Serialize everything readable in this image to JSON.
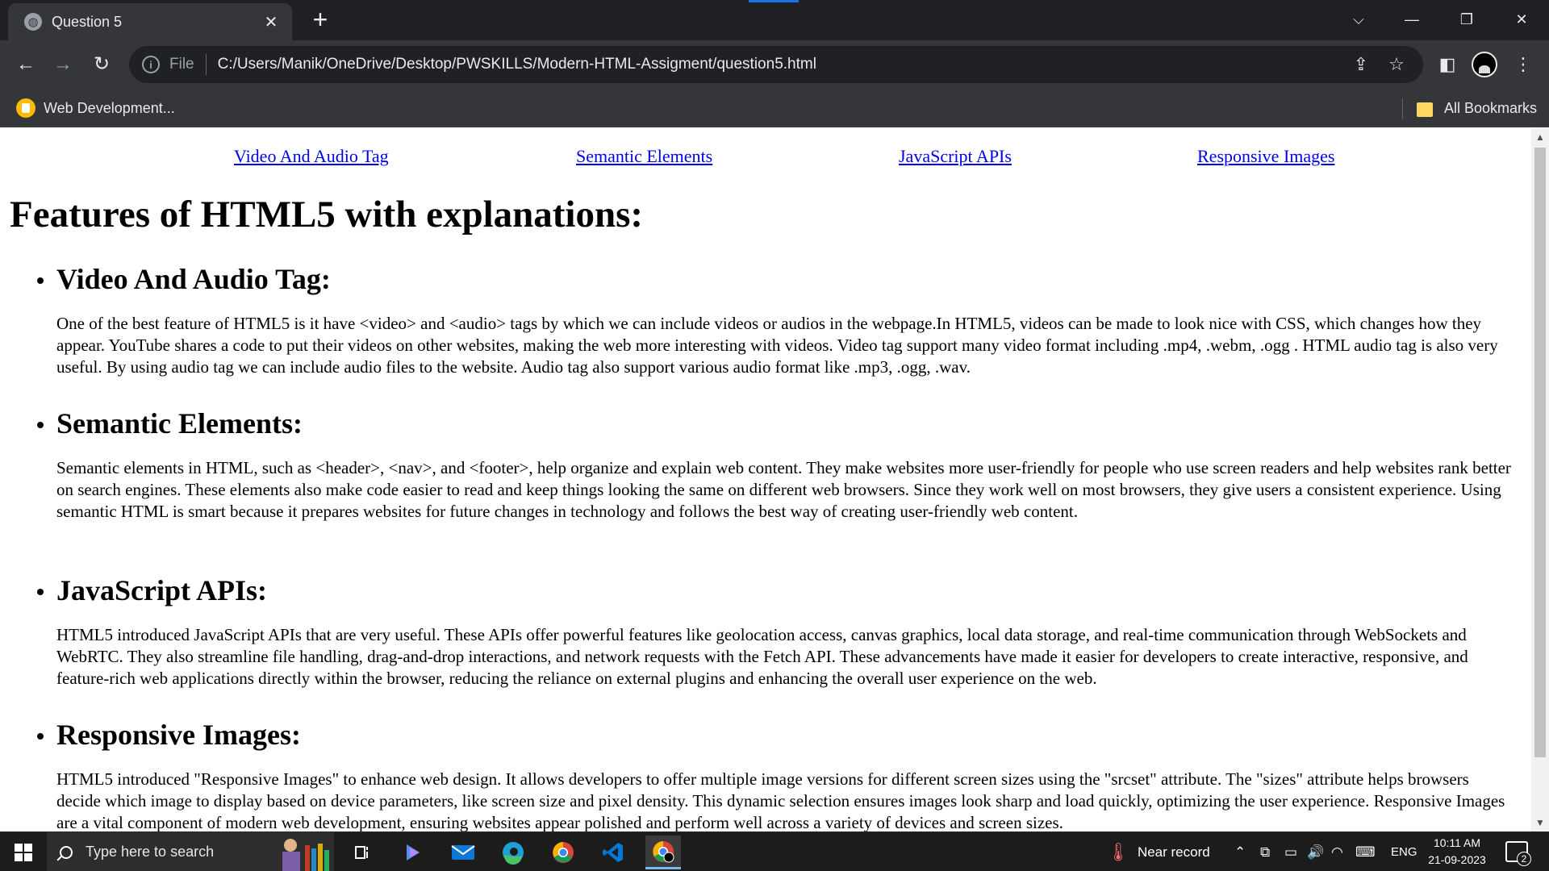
{
  "browser": {
    "tab_title": "Question 5",
    "address_scheme": "File",
    "address_url": "C:/Users/Manik/OneDrive/Desktop/PWSKILLS/Modern-HTML-Assigment/question5.html",
    "bookmark_label": "Web Development...",
    "all_bookmarks_label": "All Bookmarks",
    "accent_color": "#1a73e8"
  },
  "page": {
    "nav_links": [
      "Video And Audio Tag",
      "Semantic Elements",
      "JavaScript APIs",
      "Responsive Images"
    ],
    "title": "Features of HTML5 with explanations:",
    "sections": [
      {
        "heading": "Video And Audio Tag:",
        "body": "One of the best feature of HTML5 is it have <video> and <audio> tags by which we can include videos or audios in the webpage.In HTML5, videos can be made to look nice with CSS, which changes how they appear. YouTube shares a code to put their videos on other websites, making the web more interesting with videos. Video tag support many video format including .mp4, .webm, .ogg . HTML audio tag is also very useful. By using audio tag we can include audio files to the website. Audio tag also support various audio format like .mp3, .ogg, .wav."
      },
      {
        "heading": "Semantic Elements:",
        "body": "Semantic elements in HTML, such as <header>, <nav>, and <footer>, help organize and explain web content. They make websites more user-friendly for people who use screen readers and help websites rank better on search engines. These elements also make code easier to read and keep things looking the same on different web browsers. Since they work well on most browsers, they give users a consistent experience. Using semantic HTML is smart because it prepares websites for future changes in technology and follows the best way of creating user-friendly web content."
      },
      {
        "heading": "JavaScript APIs:",
        "body": "HTML5 introduced JavaScript APIs that are very useful. These APIs offer powerful features like geolocation access, canvas graphics, local data storage, and real-time communication through WebSockets and WebRTC. They also streamline file handling, drag-and-drop interactions, and network requests with the Fetch API. These advancements have made it easier for developers to create interactive, responsive, and feature-rich web applications directly within the browser, reducing the reliance on external plugins and enhancing the overall user experience on the web."
      },
      {
        "heading": "Responsive Images:",
        "body": "HTML5 introduced \"Responsive Images\" to enhance web design. It allows developers to offer multiple image versions for different screen sizes using the \"srcset\" attribute. The \"sizes\" attribute helps browsers decide which image to display based on device parameters, like screen size and pixel density. This dynamic selection ensures images look sharp and load quickly, optimizing the user experience. Responsive Images are a vital component of modern web development, ensuring websites appear polished and perform well across a variety of devices and screen sizes."
      }
    ]
  },
  "taskbar": {
    "search_placeholder": "Type here to search",
    "weather_text": "Near record",
    "language": "ENG",
    "time": "10:11 AM",
    "date": "21-09-2023",
    "notification_count": "2",
    "apps": [
      "task-view-icon",
      "copilot-icon",
      "mail-icon",
      "edge-icon",
      "chrome-icon",
      "vscode-icon",
      "chrome-profile-icon"
    ]
  }
}
